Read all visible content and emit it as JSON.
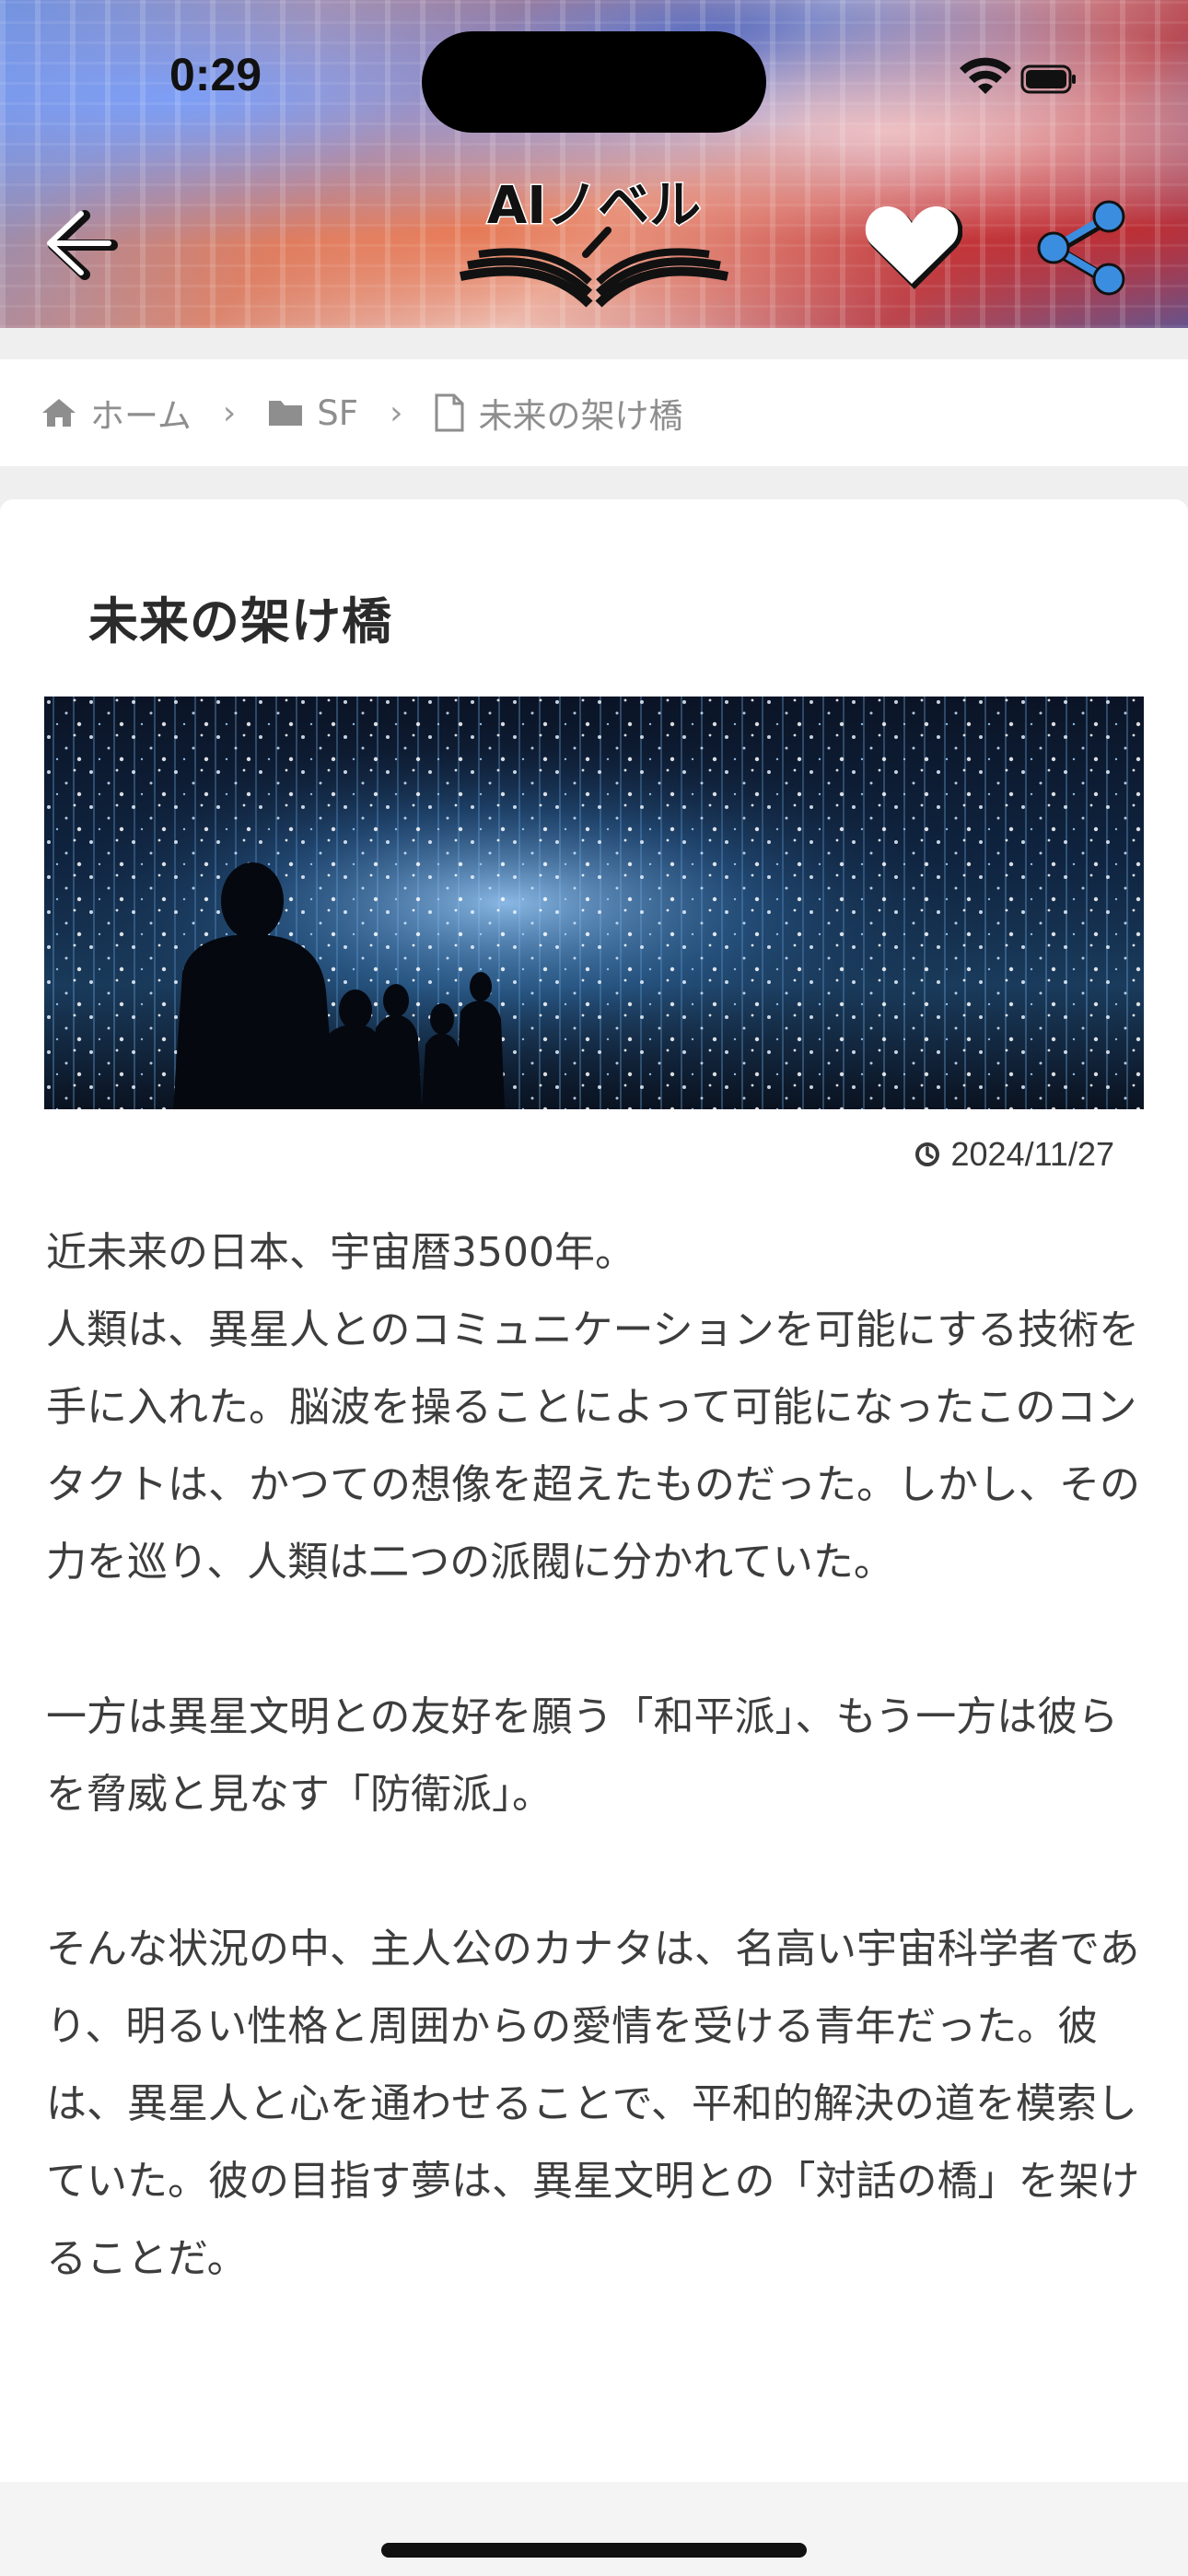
{
  "status_bar": {
    "time": "0:29"
  },
  "header": {
    "logo_text": "AIノベル",
    "colors": {
      "share_icon": "#3b8de0",
      "heart_icon": "#ffffff"
    }
  },
  "breadcrumb": {
    "items": [
      {
        "label": "ホーム",
        "icon": "home-icon"
      },
      {
        "label": "SF",
        "icon": "folder-icon"
      },
      {
        "label": "未来の架け橋",
        "icon": "document-icon"
      }
    ],
    "separator": "›"
  },
  "article": {
    "title": "未来の架け橋",
    "date": "2024/11/27",
    "paragraphs": [
      "近未来の日本、宇宙暦3500年。\n人類は、異星人とのコミュニケーションを可能にする技術を手に入れた。脳波を操ることによって可能になったこのコンタクトは、かつての想像を超えたものだった。しかし、その力を巡り、人類は二つの派閥に分かれていた。",
      "一方は異星文明との友好を願う「和平派」、もう一方は彼らを脅威と見なす「防衛派」。",
      "そんな状況の中、主人公のカナタは、名高い宇宙科学者であり、明るい性格と周囲からの愛情を受ける青年だった。彼は、異星人と心を通わせることで、平和的解決の道を模索していた。彼の目指す夢は、異星文明との「対話の橋」を架けることだ。"
    ]
  }
}
